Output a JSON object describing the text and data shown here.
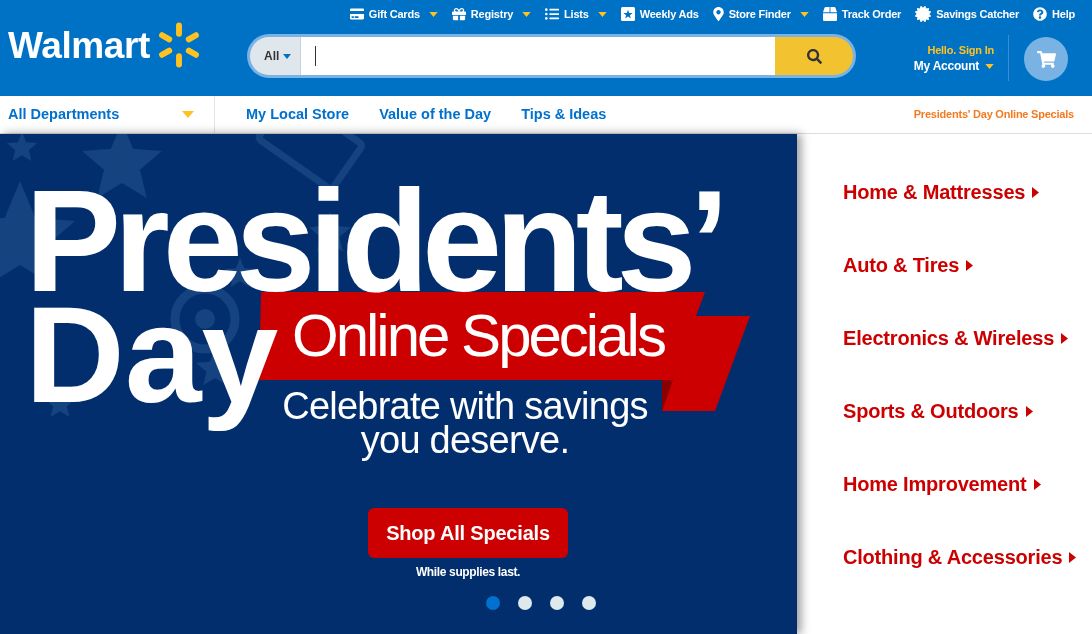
{
  "top_links": [
    {
      "label": "Gift Cards",
      "dropdown": true
    },
    {
      "label": "Registry",
      "dropdown": true
    },
    {
      "label": "Lists",
      "dropdown": true
    },
    {
      "label": "Weekly Ads",
      "dropdown": false
    },
    {
      "label": "Store Finder",
      "dropdown": true
    },
    {
      "label": "Track Order",
      "dropdown": false
    },
    {
      "label": "Savings Catcher",
      "dropdown": false
    },
    {
      "label": "Help",
      "dropdown": false
    }
  ],
  "logo": {
    "text": "Walmart"
  },
  "search": {
    "scope": "All"
  },
  "account": {
    "greeting": "Hello. Sign In",
    "label": "My Account"
  },
  "nav": {
    "departments": "All Departments",
    "links": [
      "My Local Store",
      "Value of the Day",
      "Tips & Ideas"
    ],
    "promo": "Presidents' Day Online Specials"
  },
  "hero": {
    "headline": [
      "Presidents’",
      "Day"
    ],
    "ribbon": "Online Specials",
    "subtitle": "Celebrate with savings you deserve.",
    "button": "Shop All Specials",
    "note": "While supplies last.",
    "slides": [
      {
        "selected": true
      },
      {
        "selected": false
      },
      {
        "selected": false
      },
      {
        "selected": false
      }
    ]
  },
  "categories": [
    "Home & Mattresses",
    "Auto & Tires",
    "Electronics & Wireless",
    "Sports & Outdoors",
    "Home Improvement",
    "Clothing & Accessories"
  ]
}
